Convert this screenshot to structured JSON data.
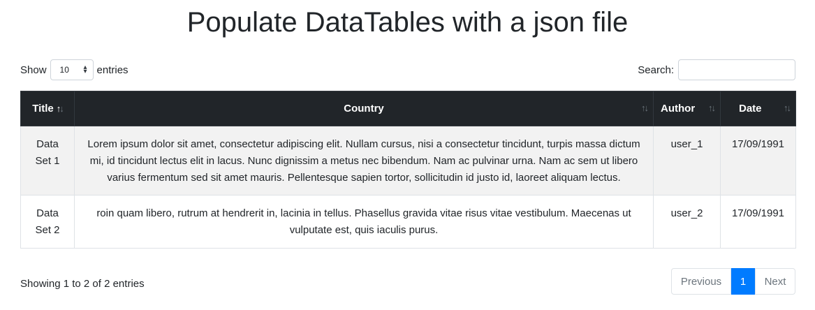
{
  "page": {
    "title": "Populate DataTables with a json file"
  },
  "length": {
    "show_label": "Show",
    "selected": "10",
    "entries_label": "entries"
  },
  "search": {
    "label": "Search:",
    "value": ""
  },
  "table": {
    "columns": [
      "Title",
      "Country",
      "Author",
      "Date"
    ],
    "sorted_column": "Title",
    "sort_direction": "ascending",
    "rows": [
      {
        "title": "Data Set 1",
        "country": "Lorem ipsum dolor sit amet, consectetur adipiscing elit. Nullam cursus, nisi a consectetur tincidunt, turpis massa dictum mi, id tincidunt lectus elit in lacus. Nunc dignissim a metus nec bibendum. Nam ac pulvinar urna. Nam ac sem ut libero varius fermentum sed sit amet mauris. Pellentesque sapien tortor, sollicitudin id justo id, laoreet aliquam lectus.",
        "author": "user_1",
        "date": "17/09/1991"
      },
      {
        "title": "Data Set 2",
        "country": "roin quam libero, rutrum at hendrerit in, lacinia in tellus. Phasellus gravida vitae risus vitae vestibulum. Maecenas ut vulputate est, quis iaculis purus.",
        "author": "user_2",
        "date": "17/09/1991"
      }
    ]
  },
  "info": {
    "text": "Showing 1 to 2 of 2 entries"
  },
  "pagination": {
    "previous": "Previous",
    "current": "1",
    "next": "Next"
  },
  "colors": {
    "header_bg": "#212529",
    "accent": "#007bff",
    "stripe": "#f2f2f2"
  }
}
